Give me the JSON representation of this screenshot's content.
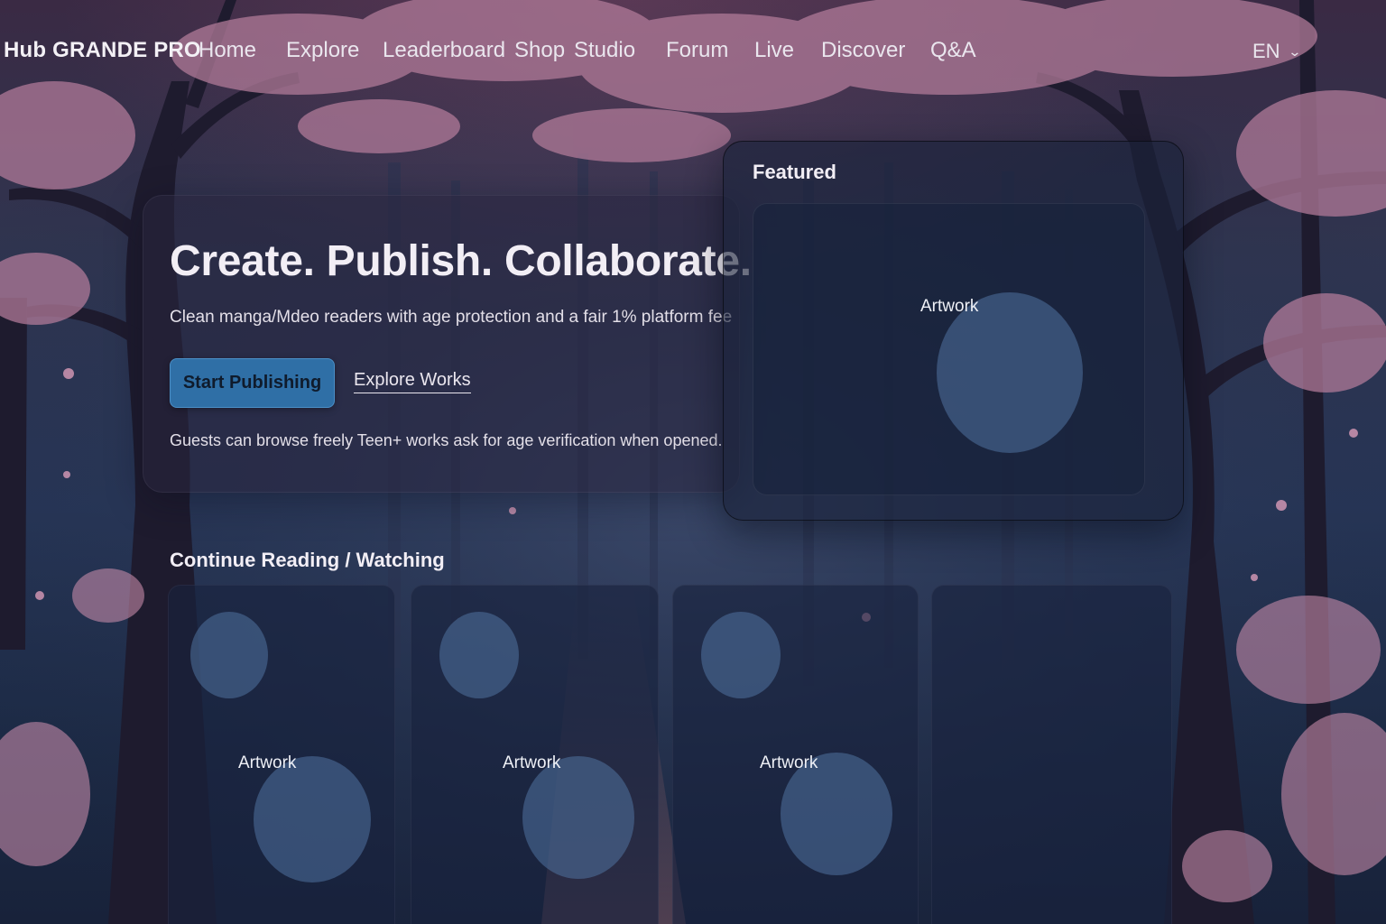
{
  "app": {
    "brand": "Hub GRANDE PRO"
  },
  "nav": {
    "items": [
      "Home",
      "Explore",
      "Leaderboard",
      "Shop",
      "Studio",
      "Forum",
      "Live",
      "Discover",
      "Q&A"
    ],
    "language": "EN"
  },
  "hero": {
    "title": "Create. Publish. Collaborate.",
    "subtitle": "Clean manga/Mdeo readers with age protection and a fair 1% platform fee",
    "primary_button": "Start Publishing",
    "secondary_link": "Explore Works",
    "note": "Guests can browse freely  Teen+ works ask for age verification when opened."
  },
  "featured": {
    "title": "Featured",
    "card_label": "Artwork"
  },
  "continue": {
    "title": "Continue Reading / Watching",
    "cards": [
      {
        "label": "Artwork"
      },
      {
        "label": "Artwork"
      },
      {
        "label": "Artwork"
      },
      {
        "label": ""
      }
    ]
  },
  "colors": {
    "primary_button": "#2f6fa6",
    "placeholder_blob": "#50739f"
  }
}
